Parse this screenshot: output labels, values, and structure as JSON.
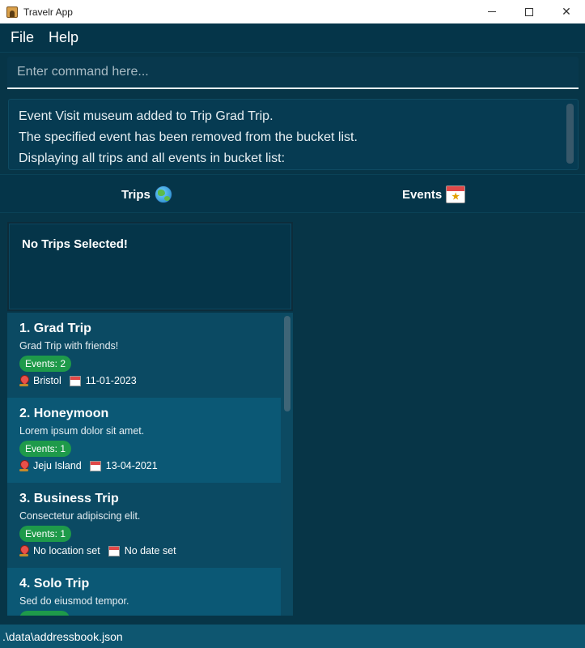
{
  "window": {
    "title": "Travelr App"
  },
  "menu": {
    "items": [
      "File",
      "Help"
    ]
  },
  "command": {
    "placeholder": "Enter command here..."
  },
  "result": {
    "lines": [
      "Event Visit museum added to Trip Grad Trip.",
      "The specified event has been removed from the bucket list.",
      "Displaying all trips and all events in bucket list:"
    ]
  },
  "tabs": {
    "trips": "Trips",
    "events": "Events"
  },
  "selected_trip": {
    "message": "No Trips Selected!"
  },
  "trips": [
    {
      "name": "1.  Grad Trip",
      "desc": "Grad Trip with friends!",
      "events": "Events: 2",
      "location": "Bristol",
      "date": "11-01-2023"
    },
    {
      "name": "2.  Honeymoon",
      "desc": "Lorem ipsum dolor sit amet.",
      "events": "Events: 1",
      "location": "Jeju Island",
      "date": "13-04-2021"
    },
    {
      "name": "3.  Business Trip",
      "desc": "Consectetur adipiscing elit.",
      "events": "Events: 1",
      "location": "No location set",
      "date": "No date set"
    },
    {
      "name": "4.  Solo Trip",
      "desc": "Sed do eiusmod tempor.",
      "events": "",
      "location": "",
      "date": ""
    }
  ],
  "status": {
    "path": ".\\data\\addressbook.json"
  }
}
